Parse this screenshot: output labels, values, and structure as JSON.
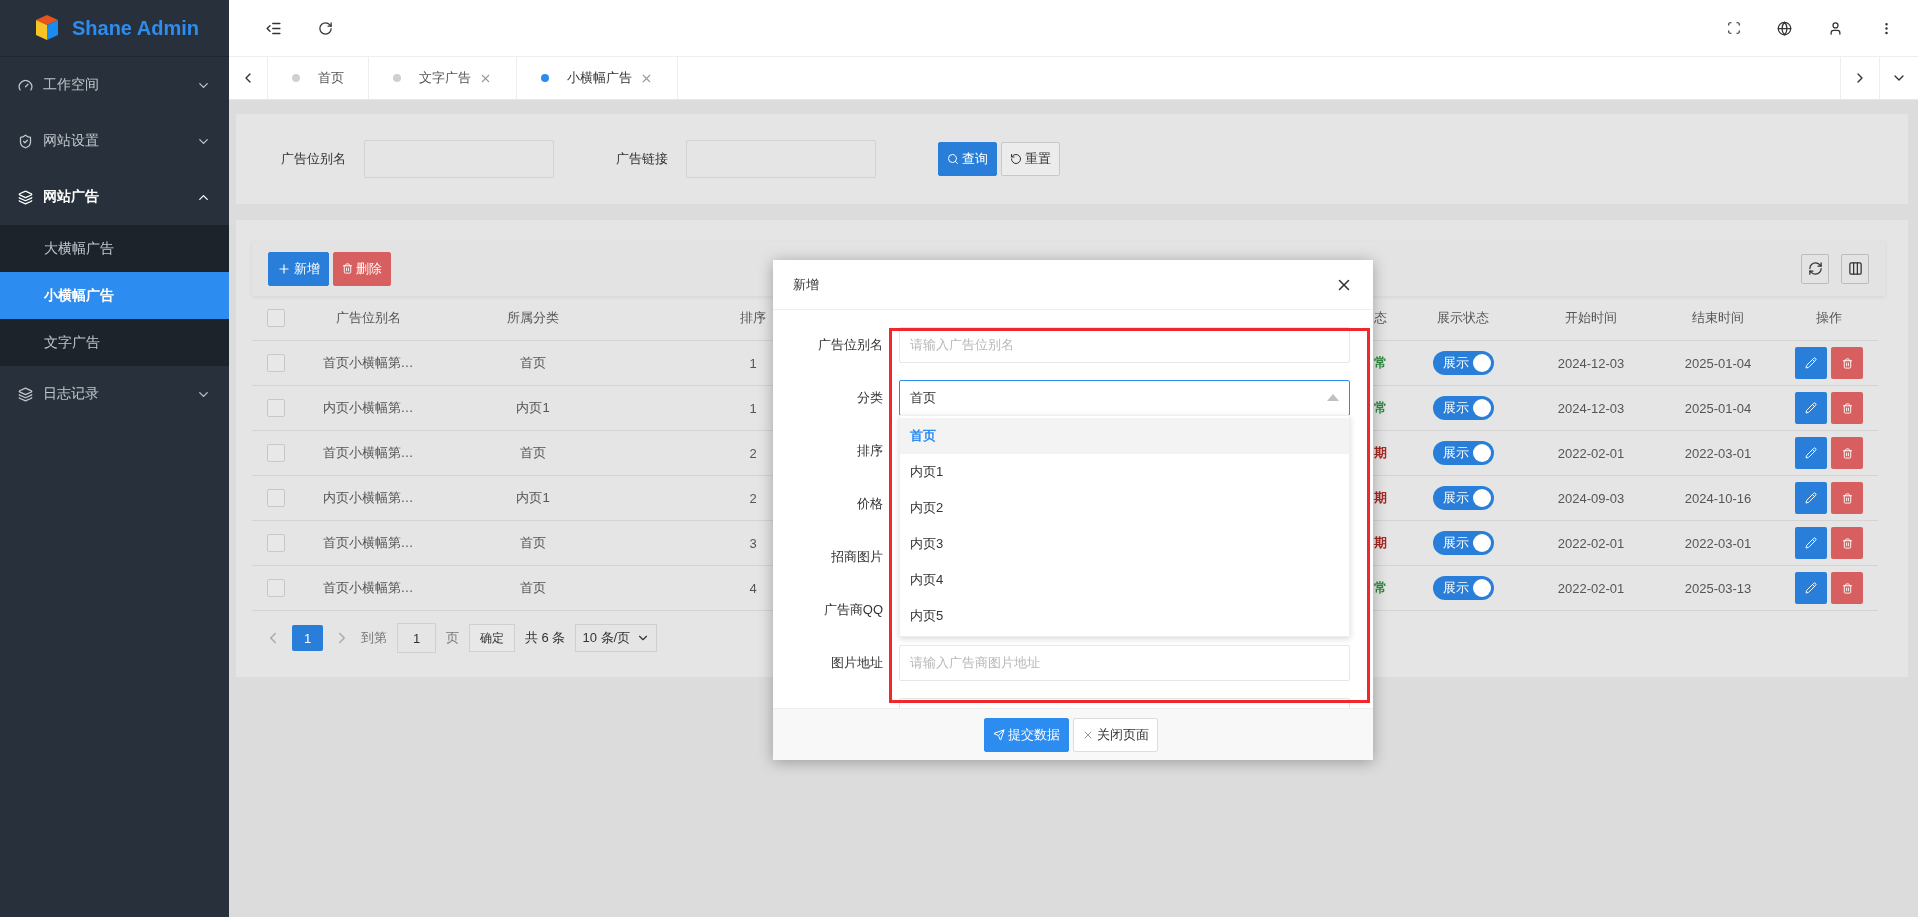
{
  "app": {
    "logo_text": "Shane Admin"
  },
  "sidebar": {
    "items": [
      {
        "label": "工作空间",
        "expanded": false
      },
      {
        "label": "网站设置",
        "expanded": false
      },
      {
        "label": "网站广告",
        "expanded": true,
        "children": [
          {
            "label": "大横幅广告",
            "selected": false
          },
          {
            "label": "小横幅广告",
            "selected": true
          },
          {
            "label": "文字广告",
            "selected": false
          }
        ]
      },
      {
        "label": "日志记录",
        "expanded": false
      }
    ]
  },
  "tabs": [
    {
      "label": "首页",
      "selected": false,
      "closable": false
    },
    {
      "label": "文字广告",
      "selected": false,
      "closable": true
    },
    {
      "label": "小横幅广告",
      "selected": true,
      "closable": true
    }
  ],
  "search": {
    "fields": [
      {
        "label": "广告位别名"
      },
      {
        "label": "广告链接"
      }
    ],
    "buttons": [
      {
        "label": "查询",
        "kind": "primary"
      },
      {
        "label": "重置",
        "kind": "default"
      }
    ]
  },
  "toolbar": {
    "buttons": [
      {
        "label": "新增",
        "kind": "primary"
      },
      {
        "label": "删除",
        "kind": "danger"
      }
    ]
  },
  "table": {
    "all_checked": false,
    "columns": [
      "广告位别名",
      "所属分类",
      "排序",
      "态",
      "展示状态",
      "开始时间",
      "结束时间",
      "操作"
    ],
    "rows": [
      {
        "checked": false,
        "name": "首页小横幅第…",
        "category": "首页",
        "sort": "1",
        "status": {
          "text": "常",
          "color": "#2e8b3e"
        },
        "show": {
          "label": "展示",
          "on": true
        },
        "start": "2024-12-03",
        "end": "2025-01-04"
      },
      {
        "checked": false,
        "name": "内页小横幅第…",
        "category": "内页1",
        "sort": "1",
        "status": {
          "text": "常",
          "color": "#2e8b3e"
        },
        "show": {
          "label": "展示",
          "on": true
        },
        "start": "2024-12-03",
        "end": "2025-01-04"
      },
      {
        "checked": false,
        "name": "首页小横幅第…",
        "category": "首页",
        "sort": "2",
        "status": {
          "text": "期",
          "color": "#a82820"
        },
        "show": {
          "label": "展示",
          "on": true
        },
        "start": "2022-02-01",
        "end": "2022-03-01"
      },
      {
        "checked": false,
        "name": "内页小横幅第…",
        "category": "内页1",
        "sort": "2",
        "status": {
          "text": "期",
          "color": "#a82820"
        },
        "show": {
          "label": "展示",
          "on": true
        },
        "start": "2024-09-03",
        "end": "2024-10-16"
      },
      {
        "checked": false,
        "name": "首页小横幅第…",
        "category": "首页",
        "sort": "3",
        "status": {
          "text": "期",
          "color": "#a82820"
        },
        "show": {
          "label": "展示",
          "on": true
        },
        "start": "2022-02-01",
        "end": "2022-03-01"
      },
      {
        "checked": false,
        "name": "首页小横幅第…",
        "category": "首页",
        "sort": "4",
        "status": {
          "text": "常",
          "color": "#2e8b3e"
        },
        "show": {
          "label": "展示",
          "on": true
        },
        "start": "2022-02-01",
        "end": "2025-03-13"
      }
    ]
  },
  "pagination": {
    "pages": [
      {
        "label": "1",
        "selected": true
      }
    ],
    "goto_label": "到第",
    "goto_value": "1",
    "page_unit": "页",
    "confirm": "确定",
    "total": "共 6 条",
    "page_size": "10 条/页"
  },
  "modal": {
    "title": "新增",
    "fields": [
      {
        "kind": "input",
        "label": "广告位别名",
        "placeholder": "请输入广告位别名"
      },
      {
        "kind": "select",
        "label": "分类",
        "value": "首页",
        "expanded": true,
        "options": [
          {
            "label": "首页",
            "selected": true
          },
          {
            "label": "内页1",
            "selected": false
          },
          {
            "label": "内页2",
            "selected": false
          },
          {
            "label": "内页3",
            "selected": false
          },
          {
            "label": "内页4",
            "selected": false
          },
          {
            "label": "内页5",
            "selected": false
          }
        ]
      },
      {
        "kind": "covered",
        "label": "排序"
      },
      {
        "kind": "covered",
        "label": "价格"
      },
      {
        "kind": "covered",
        "label": "招商图片"
      },
      {
        "kind": "covered",
        "label": "广告商QQ"
      },
      {
        "kind": "input",
        "label": "图片地址",
        "placeholder": "请输入广告商图片地址"
      },
      {
        "kind": "input"
      }
    ],
    "buttons": [
      {
        "label": "提交数据",
        "kind": "primary"
      },
      {
        "label": "关闭页面",
        "kind": "default"
      }
    ]
  }
}
